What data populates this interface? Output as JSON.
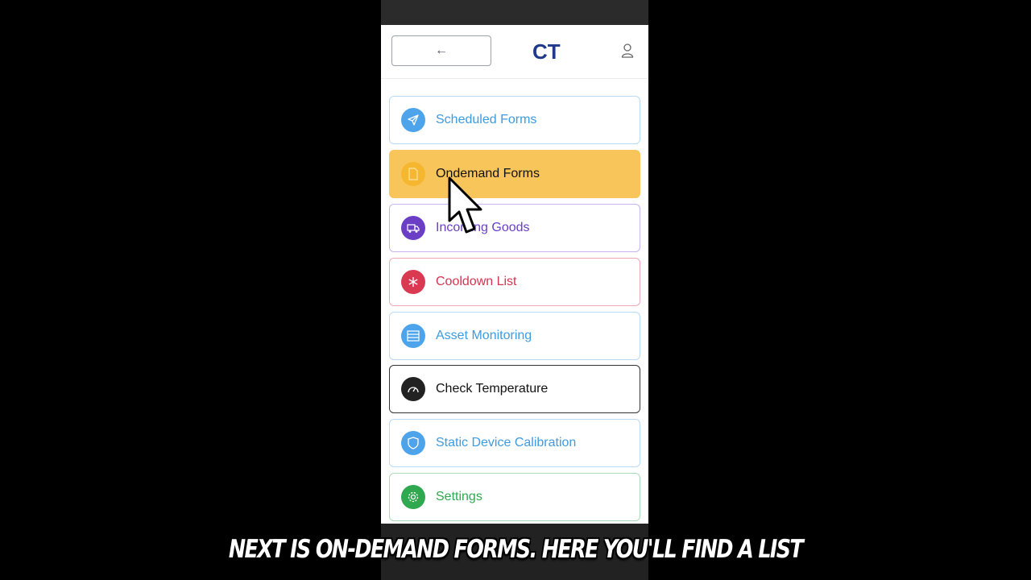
{
  "header": {
    "back_label": "←",
    "logo_text": "CT"
  },
  "menu": [
    {
      "label": "Scheduled Forms",
      "color": "#3d9be0",
      "icon": "send-icon"
    },
    {
      "label": "Ondemand Forms",
      "color": "#111111",
      "icon": "document-icon",
      "highlight": "#f8c55a"
    },
    {
      "label": "Incoming Goods",
      "color": "#6a3fc6",
      "icon": "truck-icon"
    },
    {
      "label": "Cooldown List",
      "color": "#d2354f",
      "icon": "snowflake-icon"
    },
    {
      "label": "Asset Monitoring",
      "color": "#3d9be0",
      "icon": "list-icon"
    },
    {
      "label": "Check Temperature",
      "color": "#111111",
      "icon": "gauge-icon"
    },
    {
      "label": "Static Device Calibration",
      "color": "#3d9be0",
      "icon": "shield-icon"
    },
    {
      "label": "Settings",
      "color": "#2fa84f",
      "icon": "gear-icon"
    }
  ],
  "caption": "NEXT IS ON-DEMAND FORMS. HERE YOU'LL FIND A LIST"
}
